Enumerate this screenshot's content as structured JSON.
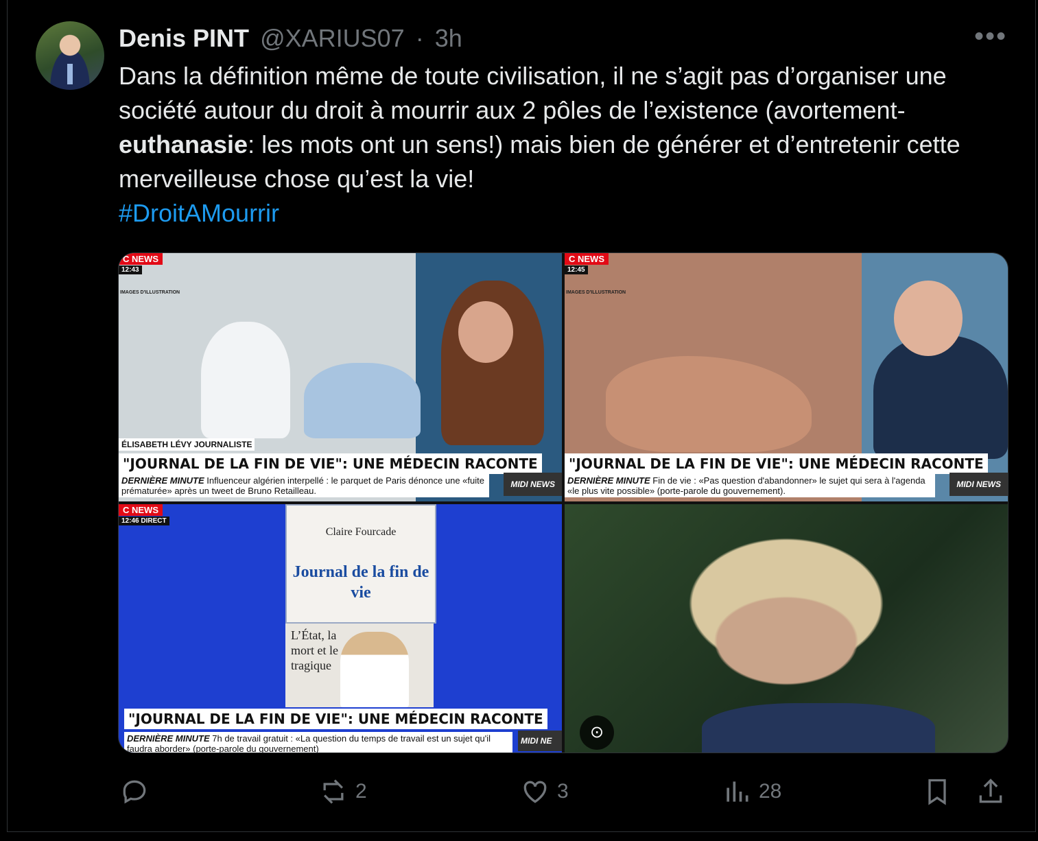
{
  "tweet": {
    "author_name": "Denis PINT",
    "handle": "@XARIUS07",
    "separator": "·",
    "time": "3h",
    "text_part1": "Dans la définition même de toute civilisation, il ne s’agit pas d’organiser une société autour du droit à mourrir aux 2 pôles de l’existence (avortement-",
    "text_bold": "euthanasie",
    "text_part2": ": les mots ont un sens!) mais bien de générer et d’entretenir cette merveilleuse chose qu’est la vie!",
    "hashtag": "#DroitAMourrir"
  },
  "media": {
    "img1": {
      "channel": "C NEWS",
      "clock": "12:43",
      "tag": "IMAGES D'ILLUSTRATION",
      "name_tag": "ÉLISABETH LÉVY  JOURNALISTE",
      "headline": "\"JOURNAL DE LA FIN DE VIE\": UNE MÉDECIN RACONTE",
      "ticker_label": "DERNIÈRE MINUTE",
      "ticker": "Influenceur algérien interpellé : le parquet de Paris dénonce une «fuite prématurée» après un tweet de Bruno Retailleau.",
      "program": "MIDI NEWS"
    },
    "img2": {
      "channel": "C NEWS",
      "clock": "12:45",
      "tag": "IMAGES D'ILLUSTRATION",
      "headline": "\"JOURNAL DE LA FIN DE VIE\": UNE MÉDECIN RACONTE",
      "ticker_label": "DERNIÈRE MINUTE",
      "ticker": "Fin de vie : «Pas question d'abandonner» le sujet qui sera à l'agenda «le plus vite possible» (porte-parole du gouvernement).",
      "program": "MIDI NEWS"
    },
    "img3": {
      "channel": "C NEWS",
      "clock": "12:46 DIRECT",
      "book_author": "Claire Fourcade",
      "book_title": "Journal de la fin de vie",
      "book_subtitle": "L’État, la mort et le tragique",
      "headline": "\"JOURNAL DE LA FIN DE VIE\": UNE MÉDECIN RACONTE",
      "ticker_label": "DERNIÈRE MINUTE",
      "ticker": "7h de travail gratuit : «La question du temps de travail est un sujet qu'il faudra aborder» (porte-parole du gouvernement)",
      "program": "MIDI NE"
    },
    "img4": {
      "lens_icon": "camera-lens-icon"
    }
  },
  "actions": {
    "replies": "",
    "reposts": "2",
    "likes": "3",
    "views": "28"
  },
  "colors": {
    "link": "#1d9bf0",
    "muted": "#71767b",
    "text": "#e7e9ea",
    "cnews_red": "#e20a16"
  }
}
